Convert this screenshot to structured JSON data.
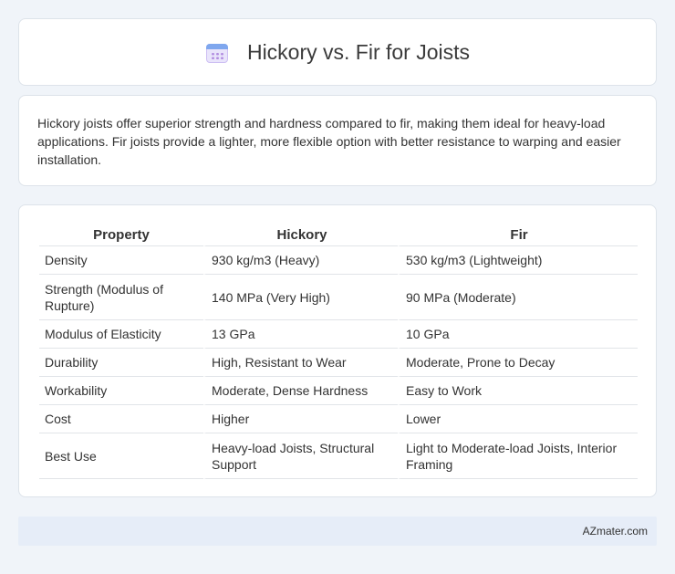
{
  "header": {
    "icon": "calendar-icon",
    "title": "Hickory vs. Fir for Joists"
  },
  "summary": {
    "text": "Hickory joists offer superior strength and hardness compared to fir, making them ideal for heavy-load applications. Fir joists provide a lighter, more flexible option with better resistance to warping and easier installation."
  },
  "table": {
    "headers": [
      "Property",
      "Hickory",
      "Fir"
    ],
    "rows": [
      [
        "Density",
        "930 kg/m3 (Heavy)",
        "530 kg/m3 (Lightweight)"
      ],
      [
        "Strength (Modulus of Rupture)",
        "140 MPa (Very High)",
        "90 MPa (Moderate)"
      ],
      [
        "Modulus of Elasticity",
        "13 GPa",
        "10 GPa"
      ],
      [
        "Durability",
        "High, Resistant to Wear",
        "Moderate, Prone to Decay"
      ],
      [
        "Workability",
        "Moderate, Dense Hardness",
        "Easy to Work"
      ],
      [
        "Cost",
        "Higher",
        "Lower"
      ],
      [
        "Best Use",
        "Heavy-load Joists, Structural Support",
        "Light to Moderate-load Joists, Interior Framing"
      ]
    ]
  },
  "footer": {
    "text": "AZmater.com"
  }
}
